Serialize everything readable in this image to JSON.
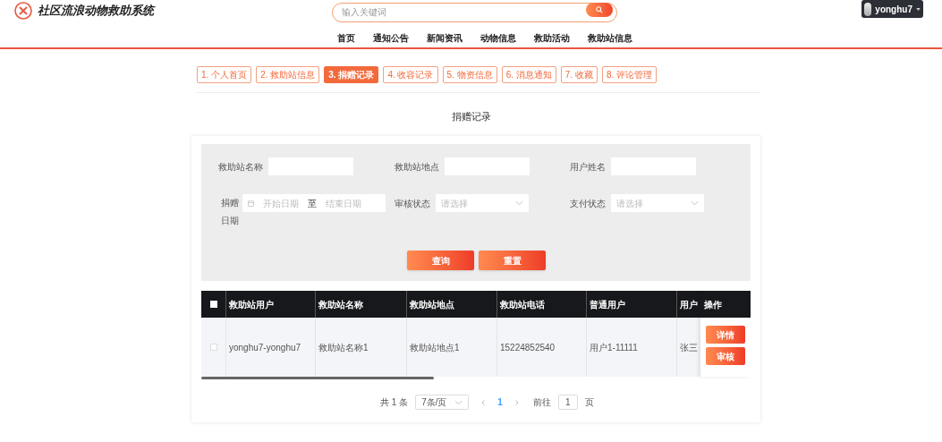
{
  "header": {
    "title": "社区流浪动物救助系统",
    "search": {
      "placeholder": "输入关键词"
    },
    "user": "yonghu7"
  },
  "nav": [
    "首页",
    "通知公告",
    "新闻资讯",
    "动物信息",
    "救助活动",
    "救助站信息"
  ],
  "tabs": [
    {
      "label": "1. 个人首页",
      "selected": false
    },
    {
      "label": "2. 救助站信息",
      "selected": false
    },
    {
      "label": "3. 捐赠记录",
      "selected": true
    },
    {
      "label": "4. 收容记录",
      "selected": false
    },
    {
      "label": "5. 物资信息",
      "selected": false
    },
    {
      "label": "6. 消息通知",
      "selected": false
    },
    {
      "label": "7. 收藏",
      "selected": false
    },
    {
      "label": "8. 评论管理",
      "selected": false
    }
  ],
  "page_title": "捐赠记录",
  "filters": {
    "row1": [
      {
        "label": "救助站名称"
      },
      {
        "label": "救助站地点"
      },
      {
        "label": "用户姓名"
      }
    ],
    "date": {
      "label": "捐赠日期",
      "start_placeholder": "开始日期",
      "separator": "至",
      "end_placeholder": "结束日期"
    },
    "selects": [
      {
        "label": "审核状态",
        "placeholder": "请选择"
      },
      {
        "label": "支付状态",
        "placeholder": "请选择"
      }
    ],
    "buttons": [
      "查询",
      "重置"
    ]
  },
  "table": {
    "select_all_checked": false,
    "columns": [
      "救助站用户",
      "救助站名称",
      "救助站地点",
      "救助站电话",
      "普通用户",
      "用户"
    ],
    "actions_column": "操作",
    "rows": [
      {
        "checked": false,
        "cells": [
          "yonghu7-yonghu7",
          "救助站名称1",
          "救助站地点1",
          "15224852540",
          "用户1-11111",
          "张三"
        ],
        "actions": [
          "详情",
          "审核"
        ]
      }
    ]
  },
  "pagination": {
    "total": "共 1 条",
    "page_size": "7条/页",
    "pages": [
      {
        "label": "1",
        "selected": true
      }
    ],
    "goto_label": "前往",
    "goto_value": "1",
    "goto_suffix": "页"
  }
}
